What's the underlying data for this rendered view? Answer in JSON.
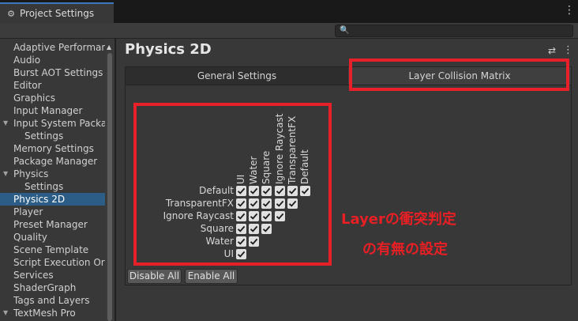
{
  "window": {
    "tab_title": "Project Settings",
    "tab_icon": "gear-icon"
  },
  "search": {
    "placeholder": "",
    "value": ""
  },
  "sidebar": {
    "items": [
      {
        "label": "Adaptive Performance",
        "indent": 0,
        "arrow": false
      },
      {
        "label": "Audio",
        "indent": 0,
        "arrow": false
      },
      {
        "label": "Burst AOT Settings",
        "indent": 0,
        "arrow": false
      },
      {
        "label": "Editor",
        "indent": 0,
        "arrow": false
      },
      {
        "label": "Graphics",
        "indent": 0,
        "arrow": false
      },
      {
        "label": "Input Manager",
        "indent": 0,
        "arrow": false
      },
      {
        "label": "Input System Package",
        "indent": 0,
        "arrow": true
      },
      {
        "label": "Settings",
        "indent": 1,
        "arrow": false
      },
      {
        "label": "Memory Settings",
        "indent": 0,
        "arrow": false
      },
      {
        "label": "Package Manager",
        "indent": 0,
        "arrow": false
      },
      {
        "label": "Physics",
        "indent": 0,
        "arrow": true
      },
      {
        "label": "Settings",
        "indent": 1,
        "arrow": false
      },
      {
        "label": "Physics 2D",
        "indent": 0,
        "arrow": false,
        "selected": true
      },
      {
        "label": "Player",
        "indent": 0,
        "arrow": false
      },
      {
        "label": "Preset Manager",
        "indent": 0,
        "arrow": false
      },
      {
        "label": "Quality",
        "indent": 0,
        "arrow": false
      },
      {
        "label": "Scene Template",
        "indent": 0,
        "arrow": false
      },
      {
        "label": "Script Execution Order",
        "indent": 0,
        "arrow": false
      },
      {
        "label": "Services",
        "indent": 0,
        "arrow": false
      },
      {
        "label": "ShaderGraph",
        "indent": 0,
        "arrow": false
      },
      {
        "label": "Tags and Layers",
        "indent": 0,
        "arrow": false
      },
      {
        "label": "TextMesh Pro",
        "indent": 0,
        "arrow": true
      }
    ]
  },
  "main": {
    "title": "Physics 2D",
    "tabs": [
      {
        "label": "General Settings",
        "active": false
      },
      {
        "label": "Layer Collision Matrix",
        "active": true
      }
    ],
    "matrix": {
      "layers": [
        "Default",
        "TransparentFX",
        "Ignore Raycast",
        "Square",
        "Water",
        "UI"
      ],
      "columns": [
        "UI",
        "Water",
        "Square",
        "Ignore Raycast",
        "TransparentFX",
        "Default"
      ],
      "checked": [
        [
          true,
          true,
          true,
          true,
          true,
          true
        ],
        [
          true,
          true,
          true,
          true,
          true
        ],
        [
          true,
          true,
          true,
          true
        ],
        [
          true,
          true,
          true
        ],
        [
          true,
          true
        ],
        [
          true
        ]
      ]
    },
    "buttons": {
      "disable_all": "Disable All",
      "enable_all": "Enable All"
    }
  },
  "annotation": {
    "line1": "Layerの衝突判定",
    "line2": "の有無の設定",
    "color": "#e81f24"
  },
  "colors": {
    "selected": "#2c5d87",
    "highlight": "#e8202a"
  }
}
